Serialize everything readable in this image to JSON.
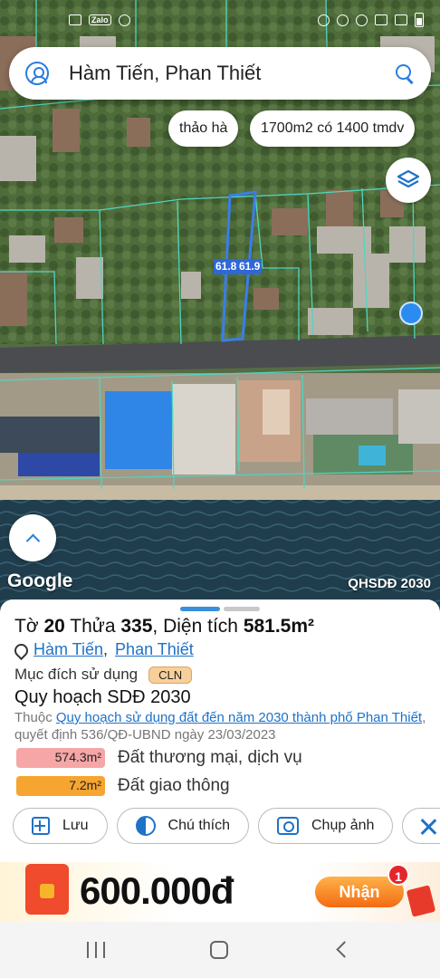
{
  "status_bar": {
    "left_icons": [
      "gallery-icon",
      "zalo-icon",
      "cloud-icon"
    ],
    "zalo_text": "Zalo",
    "right_icons": [
      "alarm-icon",
      "timer-icon",
      "location-icon",
      "wifi-icon",
      "signal-icon",
      "battery-icon"
    ]
  },
  "search": {
    "query": "Hàm Tiến, Phan Thiết"
  },
  "chips": [
    "thảo hà",
    "1700m2 có 1400 tmdv"
  ],
  "map": {
    "dimension_labels": [
      "61.8",
      "61.9"
    ],
    "google_logo": "Google",
    "overlay_tag": "QHSDĐ 2030"
  },
  "parcel": {
    "title_prefix": "Tờ",
    "sheet": "20",
    "plot_prefix": "Thửa",
    "plot": "335",
    "area_text": ", Diện tích ",
    "area": "581.5m²",
    "ward": "Hàm Tiến",
    "city": "Phan Thiết",
    "purpose_label": "Mục đích sử dụng",
    "purpose_code": "CLN",
    "plan_title": "Quy hoạch SDĐ 2030",
    "plan_prefix": "Thuộc ",
    "plan_link": "Quy hoạch sử dụng đất đến năm 2030 thành phố Phan Thiết",
    "plan_suffix": ", quyết định 536/QĐ-UBND ngày 23/03/2023",
    "legend": [
      {
        "value": "574.3m²",
        "label": "Đất thương mại, dịch vụ",
        "color": "#f6a6a6"
      },
      {
        "value": "7.2m²",
        "label": "Đất giao thông",
        "color": "#f5a530"
      }
    ]
  },
  "actions": {
    "save": "Lưu",
    "notes": "Chú thích",
    "capture": "Chụp ảnh"
  },
  "promo": {
    "amount": "600.000đ",
    "button": "Nhận",
    "badge": "1"
  },
  "colors": {
    "accent": "#1e72c8",
    "parcel_outline": "#3a7ee8",
    "boundary": "#4fd6c0"
  }
}
